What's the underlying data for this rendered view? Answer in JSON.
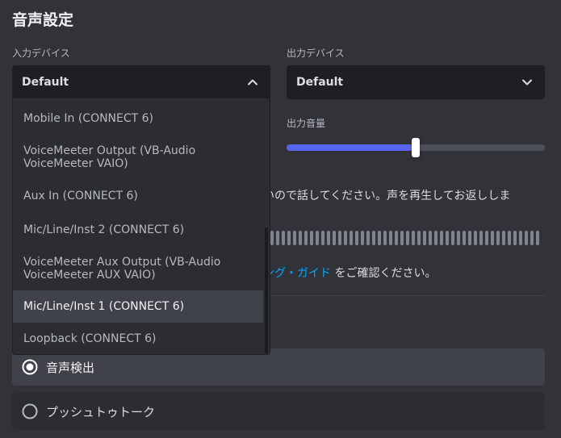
{
  "section_title": "音声設定",
  "input": {
    "label": "入力デバイス",
    "selected": "Default",
    "options": [
      "Mobile In (CONNECT 6)",
      "VoiceMeeter Output (VB-Audio VoiceMeeter VAIO)",
      "Aux In (CONNECT 6)",
      "Mic/Line/Inst 2 (CONNECT 6)",
      "VoiceMeeter Aux Output (VB-Audio VoiceMeeter AUX VAIO)",
      "Mic/Line/Inst 1 (CONNECT 6)",
      "Loopback (CONNECT 6)"
    ],
    "highlighted_index": 5
  },
  "output": {
    "label": "出力デバイス",
    "selected": "Default",
    "volume_label": "出力音量",
    "volume_fraction": 0.5
  },
  "mic_test_text": "いいので話してください。声を再生してお返ししま",
  "guide": {
    "link": "ィング・ガイド",
    "suffix": " をご確認ください。"
  },
  "input_mode": {
    "options": [
      {
        "label": "音声検出",
        "checked": true
      },
      {
        "label": "プッシュトゥトーク",
        "checked": false
      }
    ]
  },
  "colors": {
    "accent": "#5865f2",
    "link": "#00a8fc"
  }
}
